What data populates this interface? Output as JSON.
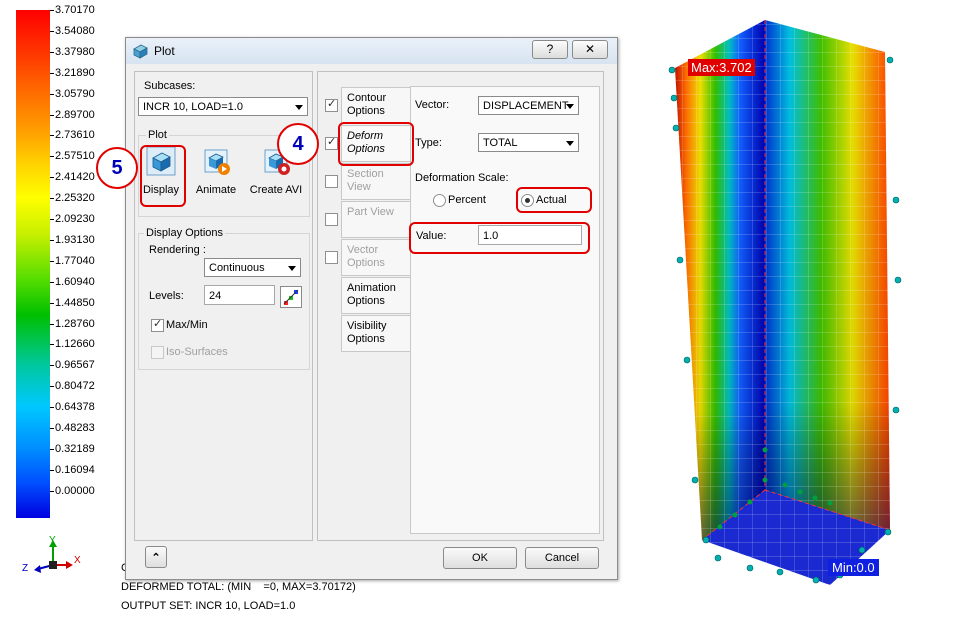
{
  "legend": {
    "values": [
      "3.70170",
      "3.54080",
      "3.37980",
      "3.21890",
      "3.05790",
      "2.89700",
      "2.73610",
      "2.57510",
      "2.41420",
      "2.25320",
      "2.09230",
      "1.93130",
      "1.77040",
      "1.60940",
      "1.44850",
      "1.28760",
      "1.12660",
      "0.96567",
      "0.80472",
      "0.64378",
      "0.48283",
      "0.32189",
      "0.16094",
      "0.00000"
    ],
    "top_color": "#ff0000",
    "bottom_color": "#0000e0"
  },
  "triad": {
    "x": "X",
    "y": "Y",
    "z": "Z"
  },
  "status": {
    "line_c": "C",
    "line1": "DEFORMED TOTAL: (MIN    =0, MAX=3.70172)",
    "line2": "OUTPUT SET: INCR 10, LOAD=1.0"
  },
  "dialog": {
    "title": "Plot",
    "help_btn": "?",
    "close_btn": "✕",
    "subcases_label": "Subcases:",
    "subcase_value": "INCR 10, LOAD=1.0",
    "plot_group": "Plot",
    "display_label": "Display",
    "animate_label": "Animate",
    "create_avi_label": "Create AVI",
    "display_options_group": "Display Options",
    "rendering_label": "Rendering :",
    "rendering_value": "Continuous",
    "levels_label": "Levels:",
    "levels_value": "24",
    "maxmin_label": "Max/Min",
    "isosurfaces_label": "Iso-Surfaces",
    "tabs": [
      {
        "label": "Contour Options",
        "checked": true
      },
      {
        "label": "Deform Options",
        "checked": true
      },
      {
        "label": "Section View",
        "checked": false
      },
      {
        "label": "Part View",
        "checked": false
      },
      {
        "label": "Vector Options",
        "checked": false
      },
      {
        "label": "Animation Options"
      },
      {
        "label": "Visibility Options"
      }
    ],
    "vector_label": "Vector:",
    "vector_value": "DISPLACEMENT",
    "type_label": "Type:",
    "type_value": "TOTAL",
    "scale_label": "Deformation Scale:",
    "percent_label": "Percent",
    "actual_label": "Actual",
    "value_label": "Value:",
    "value_value": "1.0",
    "collapse_btn": "⌃",
    "ok_label": "OK",
    "cancel_label": "Cancel"
  },
  "badges": {
    "four": "4",
    "five": "5"
  },
  "model": {
    "max_label": "Max:3.702",
    "min_label": "Min:0.0"
  }
}
